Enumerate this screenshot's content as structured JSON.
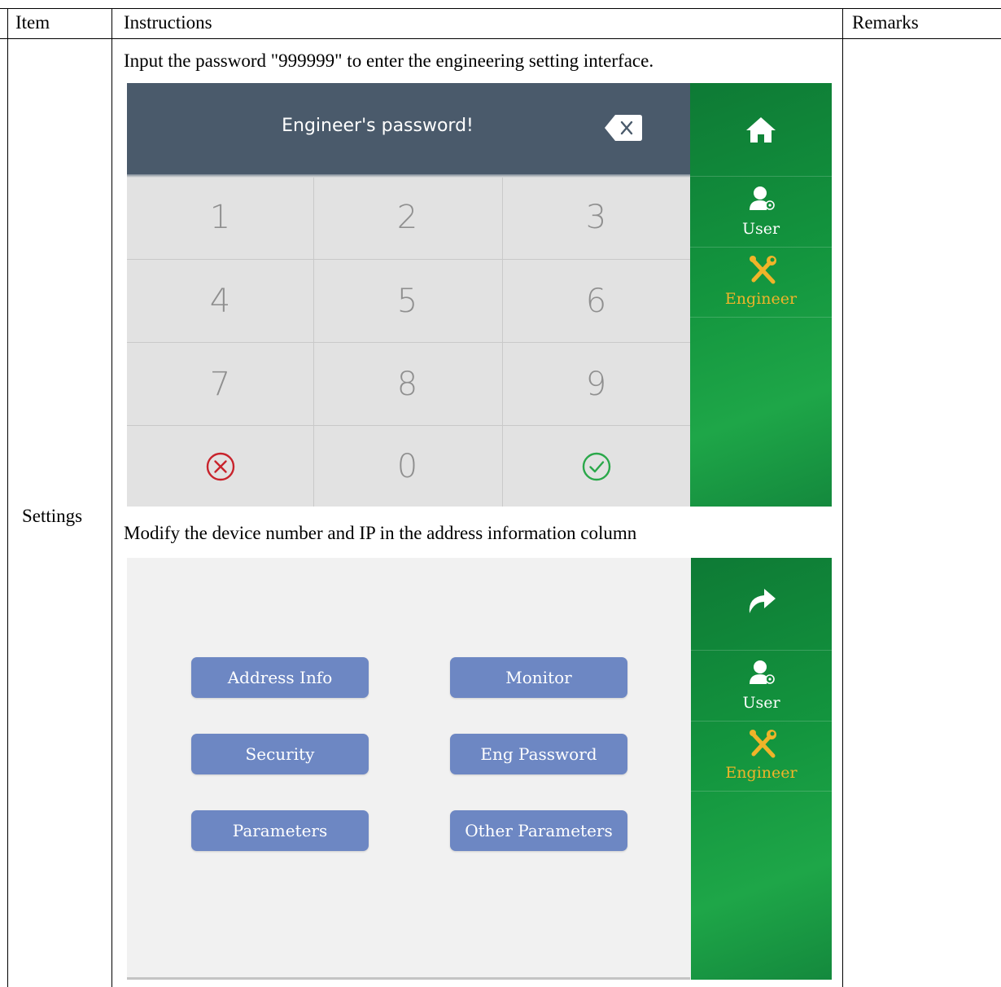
{
  "table": {
    "headers": {
      "item": "Item",
      "instructions": "Instructions",
      "remarks": "Remarks"
    },
    "row": {
      "item": "Settings",
      "instruction_1": "Input the password \"999999\" to enter the engineering setting interface.",
      "instruction_2": "Modify the device number and IP in the address information column",
      "remarks": ""
    }
  },
  "password_screen": {
    "title": "Engineer's password!",
    "keys": [
      "1",
      "2",
      "3",
      "4",
      "5",
      "6",
      "7",
      "8",
      "9",
      "0"
    ],
    "icons": {
      "backspace": "backspace-icon",
      "cancel": "cancel-circle-icon",
      "confirm": "check-circle-icon"
    },
    "sidebar": {
      "home_icon": "home-icon",
      "user_label": "User",
      "engineer_label": "Engineer"
    }
  },
  "engineer_menu": {
    "buttons": [
      "Address Info",
      "Monitor",
      "Security",
      "Eng Password",
      "Parameters",
      "Other Parameters"
    ],
    "sidebar": {
      "back_icon": "return-arrow-icon",
      "user_label": "User",
      "engineer_label": "Engineer"
    }
  },
  "colors": {
    "header_bg": "#4a5a6b",
    "keypad_bg": "#e2e2e2",
    "sidebar_green": "#13953e",
    "engineer_active": "#f0b429",
    "menu_button": "#6d87c3",
    "cancel_red": "#c8232c",
    "confirm_green": "#2aa84a"
  }
}
